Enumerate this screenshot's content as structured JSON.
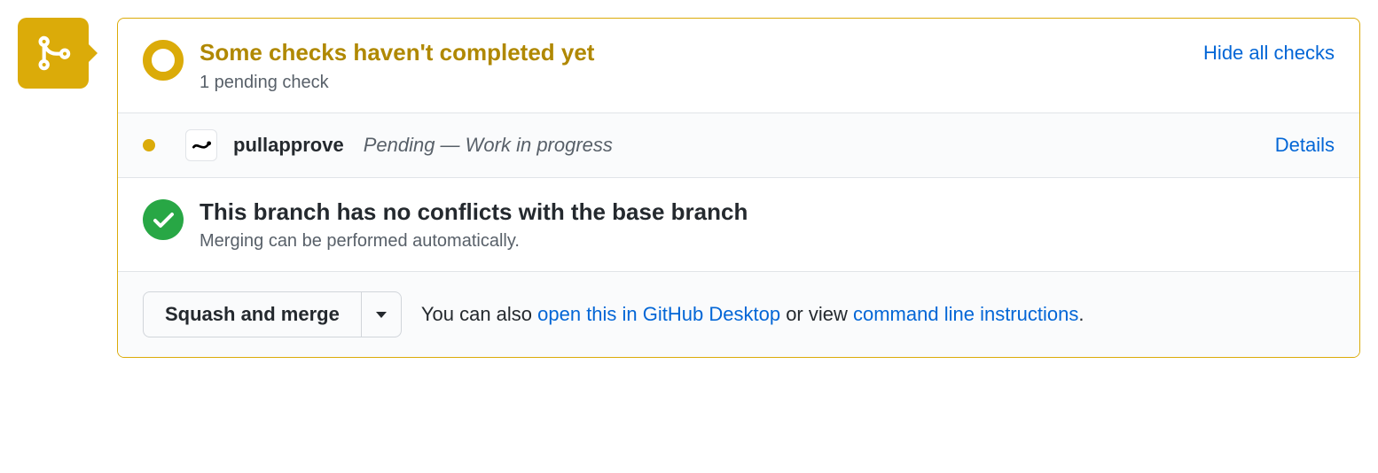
{
  "checks_header": {
    "title": "Some checks haven't completed yet",
    "subtitle": "1 pending check",
    "toggle_label": "Hide all checks"
  },
  "check_items": [
    {
      "name": "pullapprove",
      "status_text": "Pending — Work in progress",
      "details_label": "Details"
    }
  ],
  "conflicts": {
    "title": "This branch has no conflicts with the base branch",
    "subtitle": "Merging can be performed automatically."
  },
  "merge": {
    "button_label": "Squash and merge",
    "hint_prefix": "You can also ",
    "desktop_link": "open this in GitHub Desktop",
    "hint_middle": " or view ",
    "cli_link": "command line instructions",
    "hint_suffix": "."
  }
}
